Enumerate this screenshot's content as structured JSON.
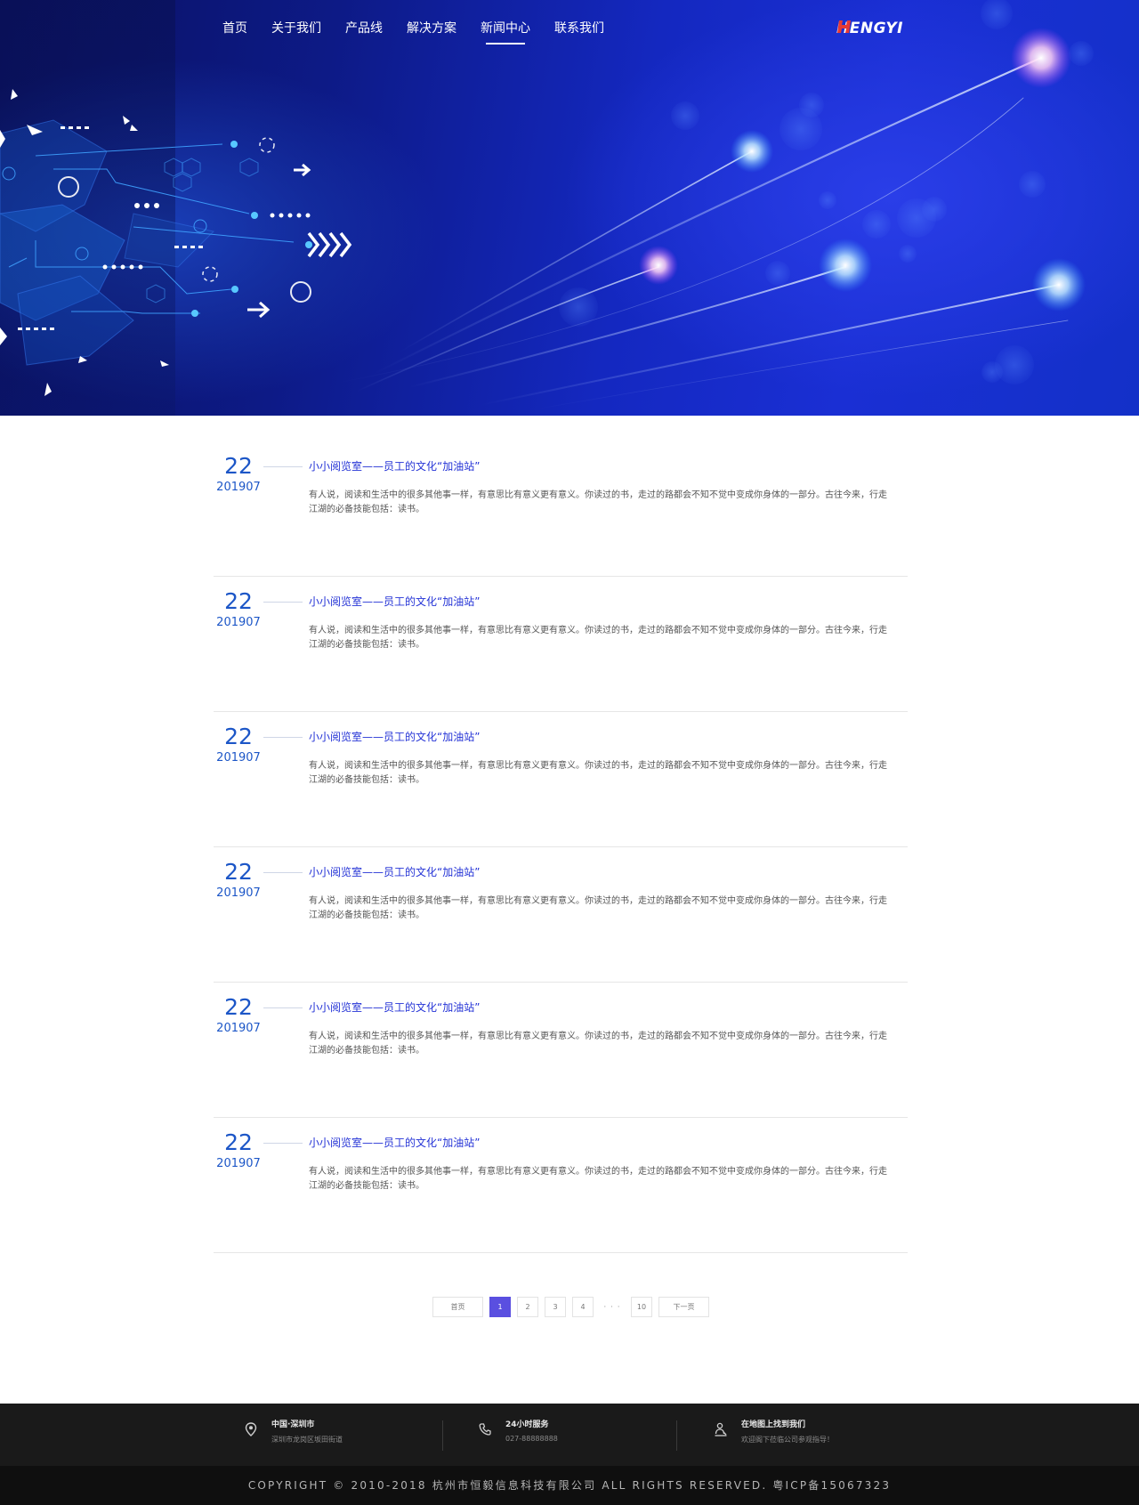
{
  "nav": {
    "items": [
      {
        "label": "首页",
        "active": false
      },
      {
        "label": "关于我们",
        "active": false
      },
      {
        "label": "产品线",
        "active": false
      },
      {
        "label": "解决方案",
        "active": false
      },
      {
        "label": "新闻中心",
        "active": true
      },
      {
        "label": "联系我们",
        "active": false
      }
    ]
  },
  "logo": {
    "text": "HENGYI",
    "mark_color": "#e53935"
  },
  "news": {
    "items": [
      {
        "day": "22",
        "year_month": "201907",
        "title": "小小阅览室——员工的文化“加油站”",
        "desc": "有人说，阅读和生活中的很多其他事一样，有意思比有意义更有意义。你读过的书，走过的路都会不知不觉中变成你身体的一部分。古往今来，行走江湖的必备技能包括：读书。"
      },
      {
        "day": "22",
        "year_month": "201907",
        "title": "小小阅览室——员工的文化“加油站”",
        "desc": "有人说，阅读和生活中的很多其他事一样，有意思比有意义更有意义。你读过的书，走过的路都会不知不觉中变成你身体的一部分。古往今来，行走江湖的必备技能包括：读书。"
      },
      {
        "day": "22",
        "year_month": "201907",
        "title": "小小阅览室——员工的文化“加油站”",
        "desc": "有人说，阅读和生活中的很多其他事一样，有意思比有意义更有意义。你读过的书，走过的路都会不知不觉中变成你身体的一部分。古往今来，行走江湖的必备技能包括：读书。"
      },
      {
        "day": "22",
        "year_month": "201907",
        "title": "小小阅览室——员工的文化“加油站”",
        "desc": "有人说，阅读和生活中的很多其他事一样，有意思比有意义更有意义。你读过的书，走过的路都会不知不觉中变成你身体的一部分。古往今来，行走江湖的必备技能包括：读书。"
      },
      {
        "day": "22",
        "year_month": "201907",
        "title": "小小阅览室——员工的文化“加油站”",
        "desc": "有人说，阅读和生活中的很多其他事一样，有意思比有意义更有意义。你读过的书，走过的路都会不知不觉中变成你身体的一部分。古往今来，行走江湖的必备技能包括：读书。"
      },
      {
        "day": "22",
        "year_month": "201907",
        "title": "小小阅览室——员工的文化“加油站”",
        "desc": "有人说，阅读和生活中的很多其他事一样，有意思比有意义更有意义。你读过的书，走过的路都会不知不觉中变成你身体的一部分。古往今来，行走江湖的必备技能包括：读书。"
      }
    ]
  },
  "pagination": {
    "first_label": "首页",
    "pages": [
      "1",
      "2",
      "3",
      "4"
    ],
    "ellipsis": "· · ·",
    "last_page": "10",
    "next_label": "下一页",
    "current": "1",
    "active_color": "#5a4fe0"
  },
  "footer": {
    "address": {
      "title": "中国·深圳市",
      "sub": "深圳市龙岗区坂田街道",
      "icon": "location-pin-icon"
    },
    "service": {
      "title": "24小时服务",
      "sub": "027-88888888",
      "icon": "phone-icon"
    },
    "map": {
      "title": "在地图上找到我们",
      "sub": "欢迎阁下莅临公司参观指导！",
      "icon": "map-person-icon"
    },
    "copyright": "COPYRIGHT © 2010-2018 杭州市恒毅信息科技有限公司 ALL RIGHTS RESERVED. 粤ICP备15067323"
  },
  "colors": {
    "accent": "#1c56c7",
    "title_blue": "#2433d6",
    "footer_bg": "#1a1a1a"
  }
}
